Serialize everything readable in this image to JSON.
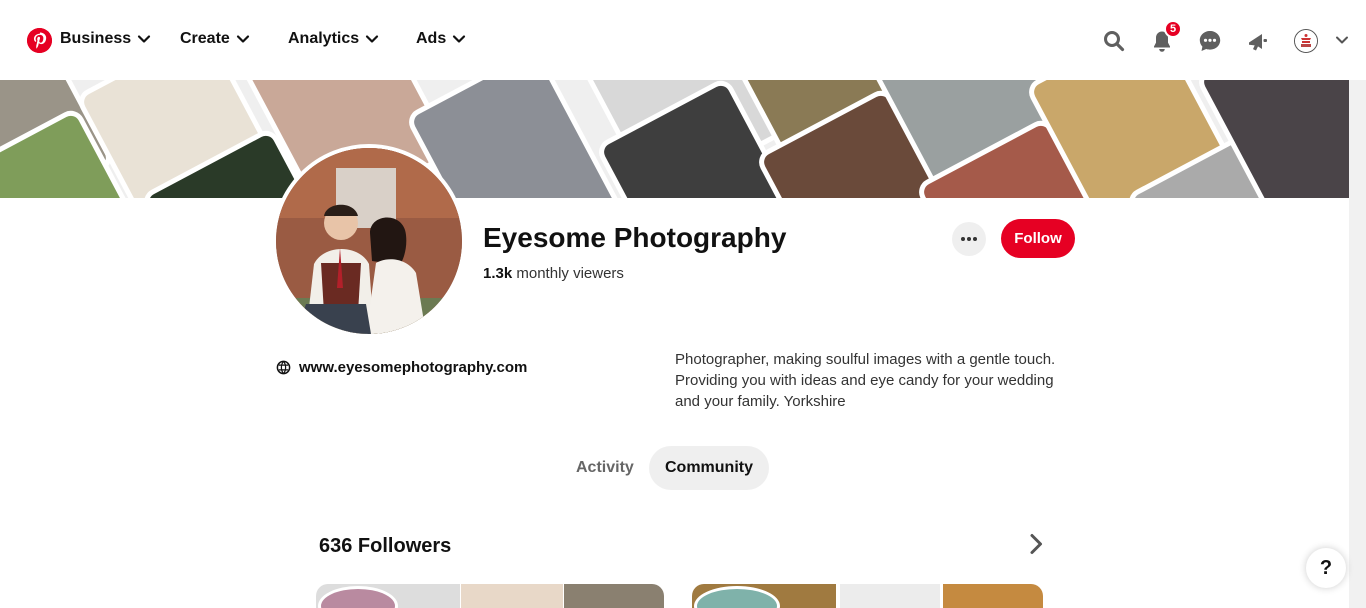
{
  "nav": {
    "items": [
      {
        "label": "Business"
      },
      {
        "label": "Create"
      },
      {
        "label": "Analytics"
      },
      {
        "label": "Ads"
      }
    ],
    "notification_count": "5",
    "icons": [
      "pinterest-logo-icon",
      "search-icon",
      "bell-icon",
      "chat-icon",
      "megaphone-icon",
      "avatar",
      "chevron-down-icon"
    ]
  },
  "profile": {
    "name": "Eyesome Photography",
    "viewers_count": "1.3k",
    "viewers_label": "monthly viewers",
    "follow_label": "Follow",
    "website": "www.eyesomephotography.com",
    "bio": "Photographer, making soulful images with a gentle touch. Providing you with ideas and eye candy for your wedding and your family. Yorkshire"
  },
  "tabs": [
    {
      "label": "Activity",
      "active": false
    },
    {
      "label": "Community",
      "active": true
    }
  ],
  "followers": {
    "title": "636 Followers"
  },
  "help": {
    "label": "?"
  },
  "colors": {
    "brand": "#e60023",
    "tab_active_bg": "#efefef"
  }
}
